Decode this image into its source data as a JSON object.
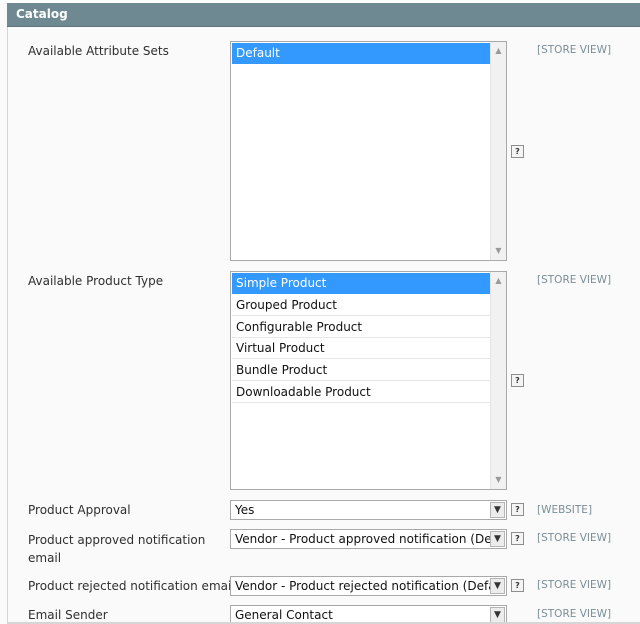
{
  "section": {
    "title": "Catalog"
  },
  "help_label": "?",
  "icons": {
    "scroll_up": "scroll-up-arrow-icon",
    "scroll_down": "scroll-down-arrow-icon",
    "dropdown": "chevron-down-icon"
  },
  "fields": {
    "attribute_sets": {
      "label": "Available Attribute Sets",
      "scope": "[STORE VIEW]",
      "options": [
        "Default"
      ],
      "selected": "Default"
    },
    "product_type": {
      "label": "Available Product Type",
      "scope": "[STORE VIEW]",
      "options": [
        "Simple Product",
        "Grouped Product",
        "Configurable Product",
        "Virtual Product",
        "Bundle Product",
        "Downloadable Product"
      ],
      "selected": "Simple Product"
    },
    "product_approval": {
      "label": "Product Approval",
      "scope": "[WEBSITE]",
      "value": "Yes"
    },
    "approved_email": {
      "label_line1": "Product approved notification",
      "label_line2": "email",
      "scope": "[STORE VIEW]",
      "value": "Vendor - Product approved notification (Default Template from Locale)"
    },
    "rejected_email": {
      "label": "Product rejected notification email",
      "scope": "[STORE VIEW]",
      "value": "Vendor - Product rejected notification (Default Template from Locale)"
    },
    "email_sender": {
      "label": "Email Sender",
      "scope": "[STORE VIEW]",
      "value": "General Contact"
    }
  },
  "colors": {
    "header": "#6f8992",
    "selection": "#3399ff",
    "scope_text": "#7a8e96"
  }
}
